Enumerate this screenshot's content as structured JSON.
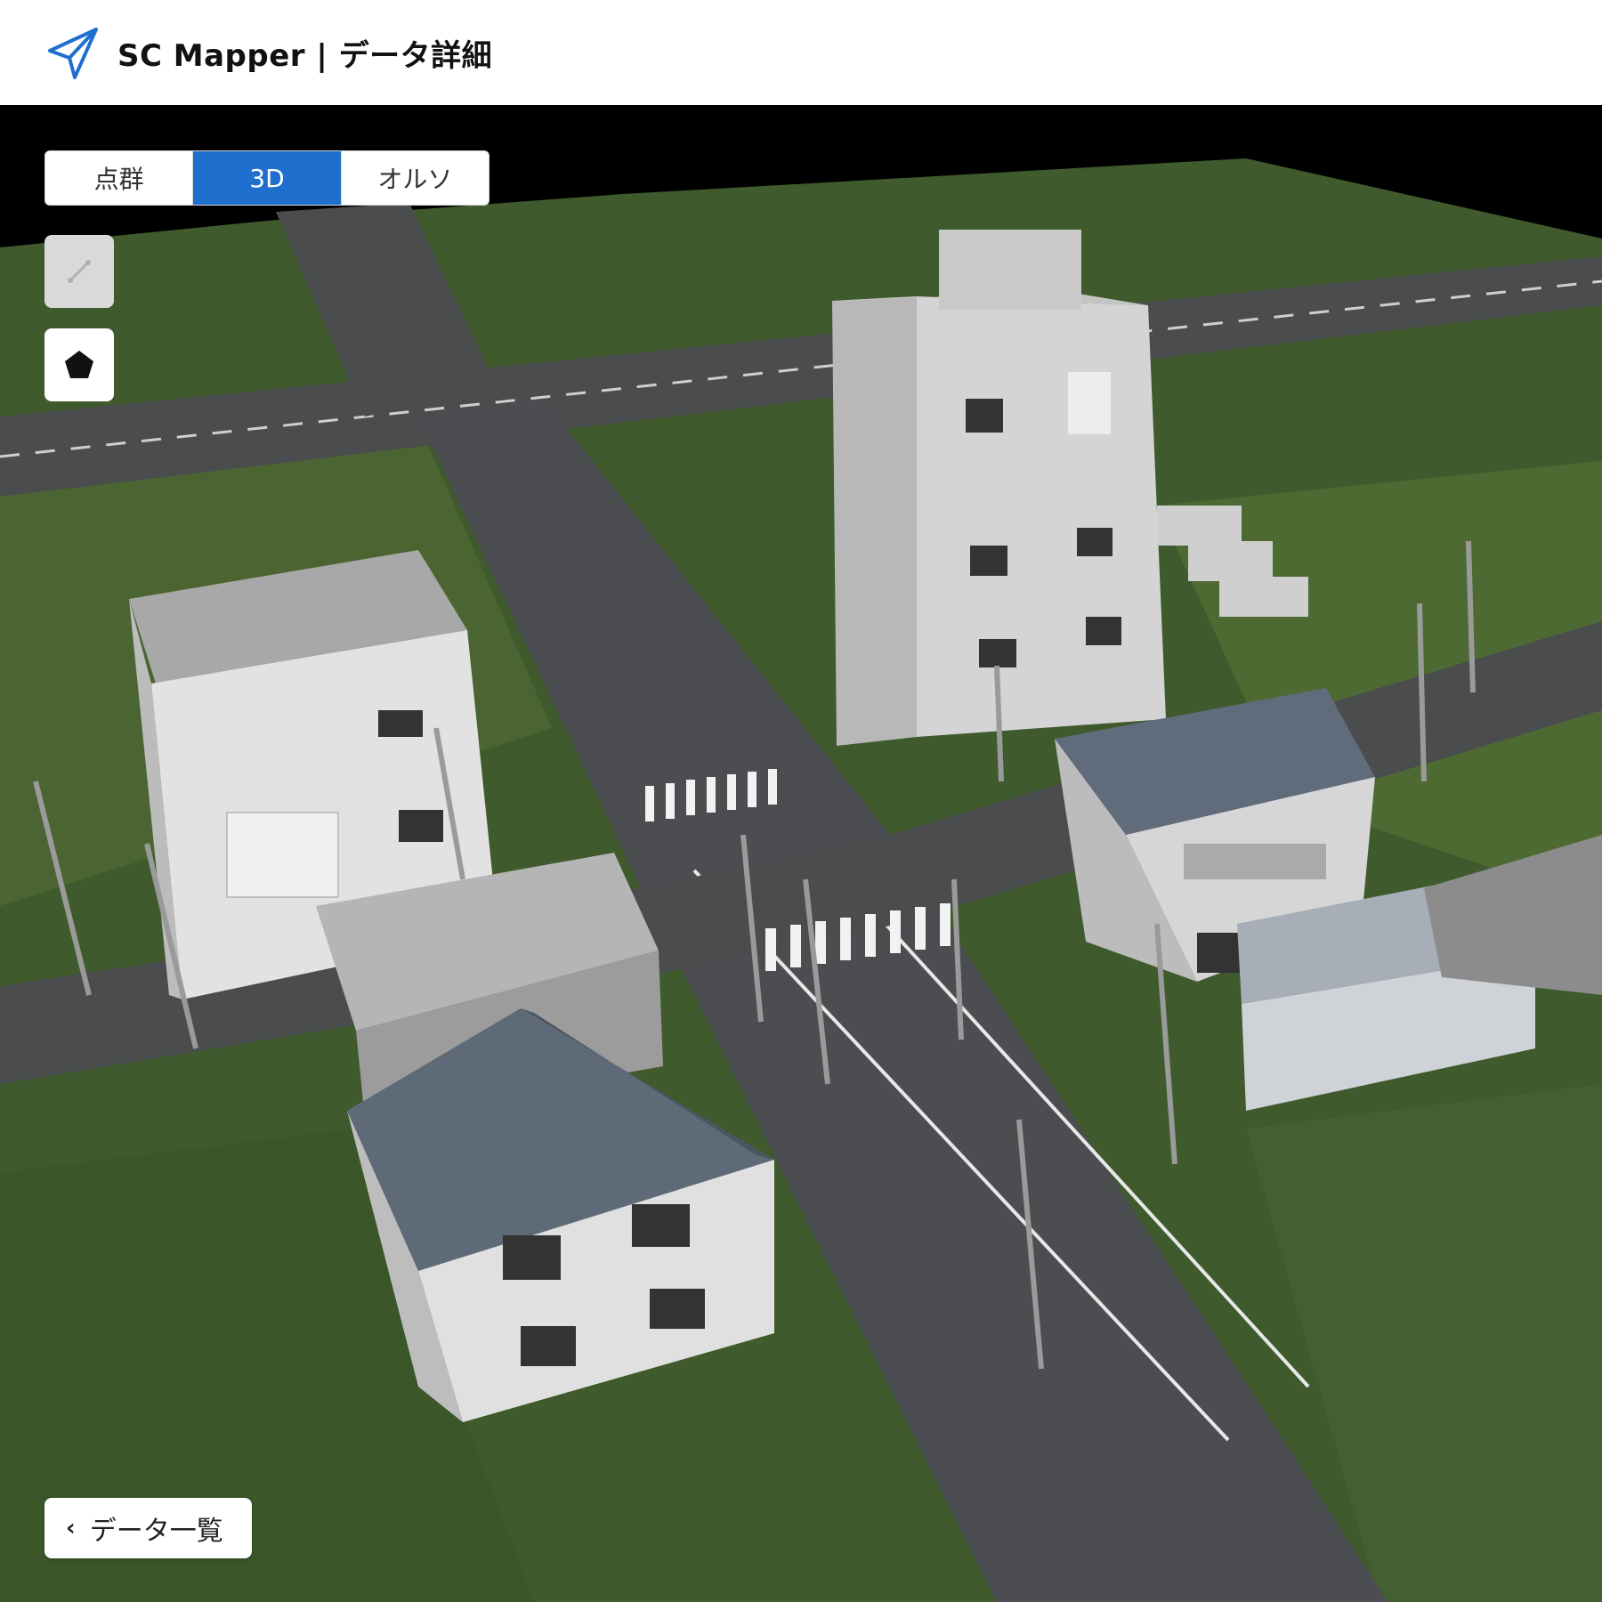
{
  "app": {
    "title": "SC Mapper | データ詳細",
    "accent_color": "#1f6fcf"
  },
  "header": {
    "logo_icon": "paper-plane-icon"
  },
  "mode_toggle": {
    "items": [
      {
        "label": "点群",
        "active": false
      },
      {
        "label": "3D",
        "active": true
      },
      {
        "label": "オルソ",
        "active": false
      }
    ]
  },
  "tools": {
    "measure_icon": "measure-line-icon",
    "polygon_icon": "pentagon-icon"
  },
  "back_button": {
    "label": "データ一覧",
    "icon": "chevron-left-icon"
  }
}
